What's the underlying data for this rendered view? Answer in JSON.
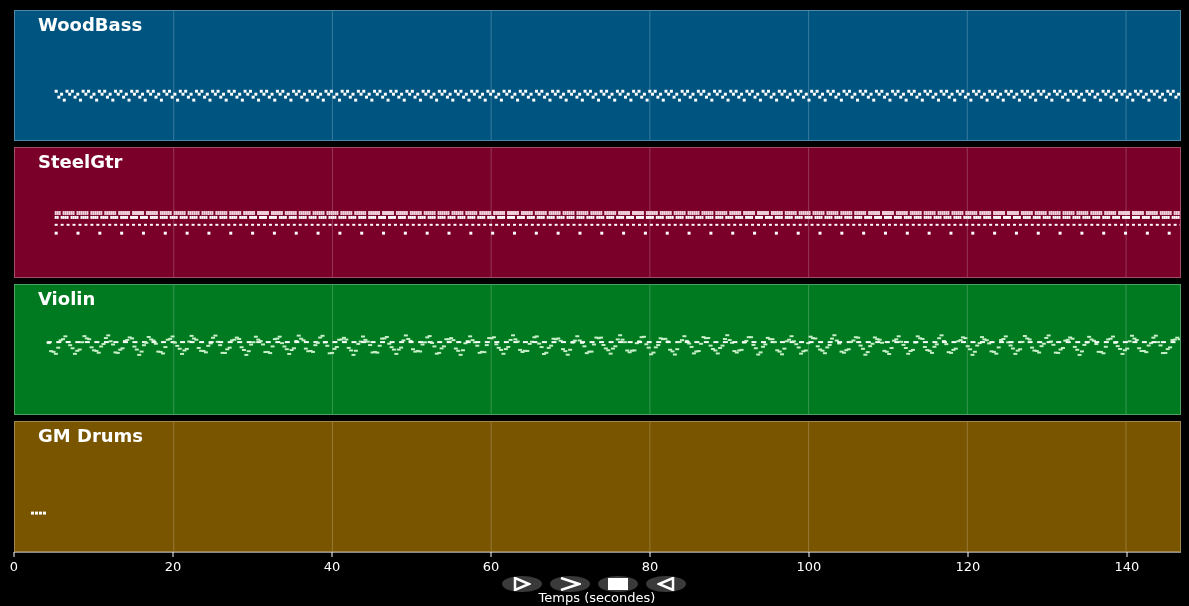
{
  "tracks": [
    {
      "name": "WoodBass",
      "color": "#005580",
      "kind": "bass"
    },
    {
      "name": "SteelGtr",
      "color": "#7a002a",
      "kind": "strum"
    },
    {
      "name": "Violin",
      "color": "#007a20",
      "kind": "melody"
    },
    {
      "name": "GM Drums",
      "color": "#7a5500",
      "kind": "drums"
    }
  ],
  "x_axis": {
    "label": "Temps (secondes)",
    "ticks": [
      "0",
      "20",
      "40",
      "60",
      "80",
      "100",
      "120",
      "140"
    ]
  },
  "controls": [
    {
      "kind": "play"
    },
    {
      "kind": "forward"
    },
    {
      "kind": "stop"
    },
    {
      "kind": "back"
    }
  ]
}
